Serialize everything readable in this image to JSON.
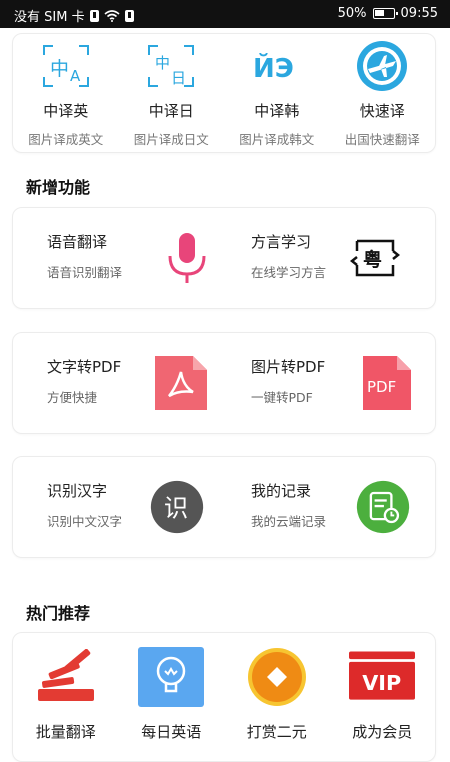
{
  "status_bar": {
    "carrier": "没有 SIM 卡",
    "battery": "50%",
    "time": "09:55"
  },
  "translate_modes": [
    {
      "title": "中译英",
      "subtitle": "图片译成英文",
      "icon": "zh-en-icon"
    },
    {
      "title": "中译日",
      "subtitle": "图片译成日文",
      "icon": "zh-jp-icon"
    },
    {
      "title": "中译韩",
      "subtitle": "图片译成韩文",
      "icon": "zh-kr-icon"
    },
    {
      "title": "快速译",
      "subtitle": "出国快速翻译",
      "icon": "airplane-icon"
    }
  ],
  "new_features": {
    "title": "新增功能",
    "rows": [
      [
        {
          "title": "语音翻译",
          "subtitle": "语音识别翻译",
          "icon": "microphone-icon",
          "color": "#e8457a"
        },
        {
          "title": "方言学习",
          "subtitle": "在线学习方言",
          "icon": "dialect-icon",
          "glyph": "粤"
        }
      ],
      [
        {
          "title": "文字转PDF",
          "subtitle": "方便快捷",
          "icon": "pdf-acrobat-icon",
          "color": "#f06672"
        },
        {
          "title": "图片转PDF",
          "subtitle": "一键转PDF",
          "icon": "pdf-file-icon",
          "color": "#f05667",
          "label": "PDF"
        }
      ],
      [
        {
          "title": "识别汉字",
          "subtitle": "识别中文汉字",
          "icon": "chinese-char-icon",
          "color": "#555555",
          "glyph": "识"
        },
        {
          "title": "我的记录",
          "subtitle": "我的云端记录",
          "icon": "record-icon",
          "color": "#4caf3e"
        }
      ]
    ]
  },
  "hot_recommend": {
    "title": "热门推荐",
    "items": [
      {
        "title": "批量翻译",
        "icon": "stack-icon",
        "color": "#e33b33"
      },
      {
        "title": "每日英语",
        "icon": "lightbulb-icon",
        "color": "#5aa7f0"
      },
      {
        "title": "打赏二元",
        "icon": "coin-icon",
        "color": "#f5a623"
      },
      {
        "title": "成为会员",
        "icon": "vip-icon",
        "color": "#dd2a2a",
        "label": "VIP"
      }
    ]
  }
}
